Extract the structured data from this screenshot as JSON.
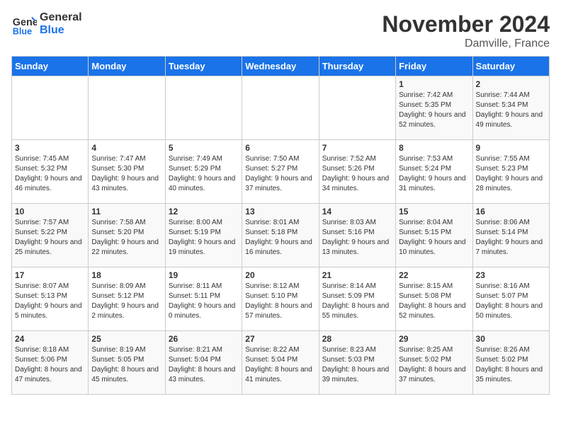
{
  "header": {
    "logo_line1": "General",
    "logo_line2": "Blue",
    "month": "November 2024",
    "location": "Damville, France"
  },
  "days_of_week": [
    "Sunday",
    "Monday",
    "Tuesday",
    "Wednesday",
    "Thursday",
    "Friday",
    "Saturday"
  ],
  "weeks": [
    [
      {
        "day": "",
        "info": ""
      },
      {
        "day": "",
        "info": ""
      },
      {
        "day": "",
        "info": ""
      },
      {
        "day": "",
        "info": ""
      },
      {
        "day": "",
        "info": ""
      },
      {
        "day": "1",
        "info": "Sunrise: 7:42 AM\nSunset: 5:35 PM\nDaylight: 9 hours and 52 minutes."
      },
      {
        "day": "2",
        "info": "Sunrise: 7:44 AM\nSunset: 5:34 PM\nDaylight: 9 hours and 49 minutes."
      }
    ],
    [
      {
        "day": "3",
        "info": "Sunrise: 7:45 AM\nSunset: 5:32 PM\nDaylight: 9 hours and 46 minutes."
      },
      {
        "day": "4",
        "info": "Sunrise: 7:47 AM\nSunset: 5:30 PM\nDaylight: 9 hours and 43 minutes."
      },
      {
        "day": "5",
        "info": "Sunrise: 7:49 AM\nSunset: 5:29 PM\nDaylight: 9 hours and 40 minutes."
      },
      {
        "day": "6",
        "info": "Sunrise: 7:50 AM\nSunset: 5:27 PM\nDaylight: 9 hours and 37 minutes."
      },
      {
        "day": "7",
        "info": "Sunrise: 7:52 AM\nSunset: 5:26 PM\nDaylight: 9 hours and 34 minutes."
      },
      {
        "day": "8",
        "info": "Sunrise: 7:53 AM\nSunset: 5:24 PM\nDaylight: 9 hours and 31 minutes."
      },
      {
        "day": "9",
        "info": "Sunrise: 7:55 AM\nSunset: 5:23 PM\nDaylight: 9 hours and 28 minutes."
      }
    ],
    [
      {
        "day": "10",
        "info": "Sunrise: 7:57 AM\nSunset: 5:22 PM\nDaylight: 9 hours and 25 minutes."
      },
      {
        "day": "11",
        "info": "Sunrise: 7:58 AM\nSunset: 5:20 PM\nDaylight: 9 hours and 22 minutes."
      },
      {
        "day": "12",
        "info": "Sunrise: 8:00 AM\nSunset: 5:19 PM\nDaylight: 9 hours and 19 minutes."
      },
      {
        "day": "13",
        "info": "Sunrise: 8:01 AM\nSunset: 5:18 PM\nDaylight: 9 hours and 16 minutes."
      },
      {
        "day": "14",
        "info": "Sunrise: 8:03 AM\nSunset: 5:16 PM\nDaylight: 9 hours and 13 minutes."
      },
      {
        "day": "15",
        "info": "Sunrise: 8:04 AM\nSunset: 5:15 PM\nDaylight: 9 hours and 10 minutes."
      },
      {
        "day": "16",
        "info": "Sunrise: 8:06 AM\nSunset: 5:14 PM\nDaylight: 9 hours and 7 minutes."
      }
    ],
    [
      {
        "day": "17",
        "info": "Sunrise: 8:07 AM\nSunset: 5:13 PM\nDaylight: 9 hours and 5 minutes."
      },
      {
        "day": "18",
        "info": "Sunrise: 8:09 AM\nSunset: 5:12 PM\nDaylight: 9 hours and 2 minutes."
      },
      {
        "day": "19",
        "info": "Sunrise: 8:11 AM\nSunset: 5:11 PM\nDaylight: 9 hours and 0 minutes."
      },
      {
        "day": "20",
        "info": "Sunrise: 8:12 AM\nSunset: 5:10 PM\nDaylight: 8 hours and 57 minutes."
      },
      {
        "day": "21",
        "info": "Sunrise: 8:14 AM\nSunset: 5:09 PM\nDaylight: 8 hours and 55 minutes."
      },
      {
        "day": "22",
        "info": "Sunrise: 8:15 AM\nSunset: 5:08 PM\nDaylight: 8 hours and 52 minutes."
      },
      {
        "day": "23",
        "info": "Sunrise: 8:16 AM\nSunset: 5:07 PM\nDaylight: 8 hours and 50 minutes."
      }
    ],
    [
      {
        "day": "24",
        "info": "Sunrise: 8:18 AM\nSunset: 5:06 PM\nDaylight: 8 hours and 47 minutes."
      },
      {
        "day": "25",
        "info": "Sunrise: 8:19 AM\nSunset: 5:05 PM\nDaylight: 8 hours and 45 minutes."
      },
      {
        "day": "26",
        "info": "Sunrise: 8:21 AM\nSunset: 5:04 PM\nDaylight: 8 hours and 43 minutes."
      },
      {
        "day": "27",
        "info": "Sunrise: 8:22 AM\nSunset: 5:04 PM\nDaylight: 8 hours and 41 minutes."
      },
      {
        "day": "28",
        "info": "Sunrise: 8:23 AM\nSunset: 5:03 PM\nDaylight: 8 hours and 39 minutes."
      },
      {
        "day": "29",
        "info": "Sunrise: 8:25 AM\nSunset: 5:02 PM\nDaylight: 8 hours and 37 minutes."
      },
      {
        "day": "30",
        "info": "Sunrise: 8:26 AM\nSunset: 5:02 PM\nDaylight: 8 hours and 35 minutes."
      }
    ]
  ]
}
